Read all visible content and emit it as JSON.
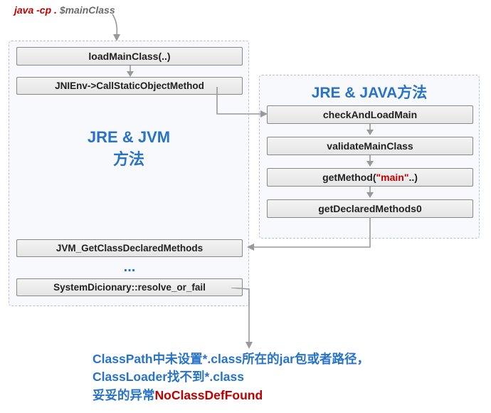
{
  "command": {
    "java": "java -cp . ",
    "main": "$mainClass"
  },
  "left": {
    "title1": "JRE & JVM",
    "title2": "方法",
    "n1": "loadMainClass(..)",
    "n2": "JNIEnv->CallStaticObjectMethod",
    "n3": "JVM_GetClassDeclaredMethods",
    "dots": "...",
    "n4": "SystemDicionary::resolve_or_fail"
  },
  "right": {
    "title": "JRE & JAVA方法",
    "n1": "checkAndLoadMain",
    "n2": "validateMainClass",
    "n3a": "getMethod(",
    "n3b": "\"main\"",
    "n3c": "..)",
    "n4": "getDeclaredMethods0"
  },
  "conclusion": {
    "l1": "ClassPath中未设置*.class所在的jar包或者路径，",
    "l2": "ClassLoader找不到*.class",
    "l3a": "妥妥的异常",
    "l3b": "NoClassDefFound"
  }
}
